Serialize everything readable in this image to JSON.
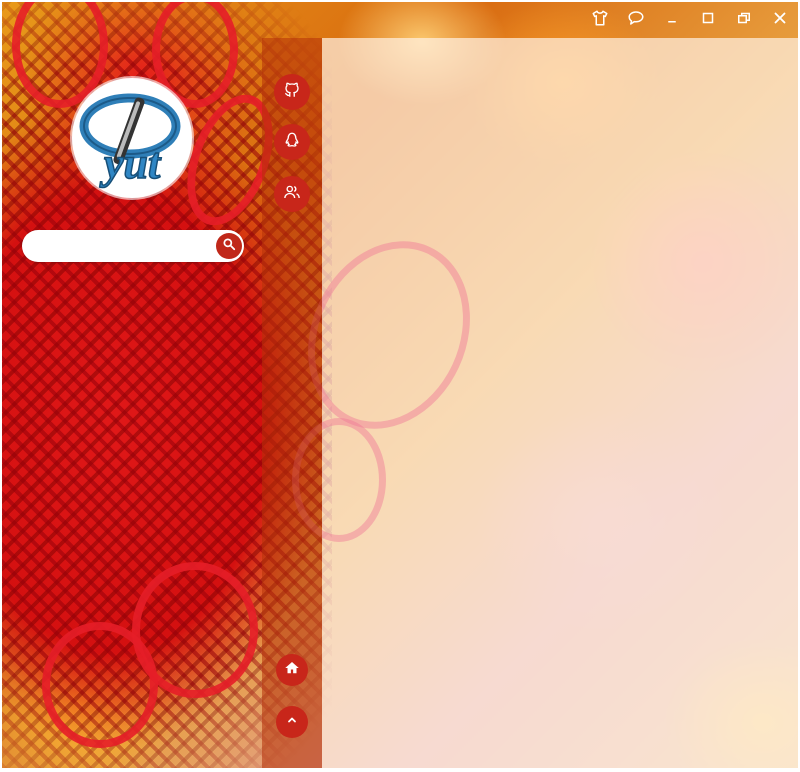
{
  "app": {
    "accent_color": "#c8261a",
    "logo_text": "yut"
  },
  "titlebar": {
    "buttons": [
      {
        "icon": "tshirt-icon",
        "name": "skin-button"
      },
      {
        "icon": "chat-bubble-icon",
        "name": "feedback-button"
      },
      {
        "icon": "minimize-icon",
        "name": "minimize-button"
      },
      {
        "icon": "maximize-icon",
        "name": "maximize-button"
      },
      {
        "icon": "restore-icon",
        "name": "restore-button"
      },
      {
        "icon": "close-icon",
        "name": "close-button"
      }
    ]
  },
  "search": {
    "placeholder": "",
    "value": "",
    "icon": "search-icon"
  },
  "sidebar": {
    "top_items": [
      {
        "icon": "github-icon"
      },
      {
        "icon": "qq-penguin-icon"
      },
      {
        "icon": "users-icon"
      }
    ],
    "bottom_items": [
      {
        "icon": "home-icon"
      },
      {
        "icon": "chevron-up-icon"
      }
    ]
  }
}
